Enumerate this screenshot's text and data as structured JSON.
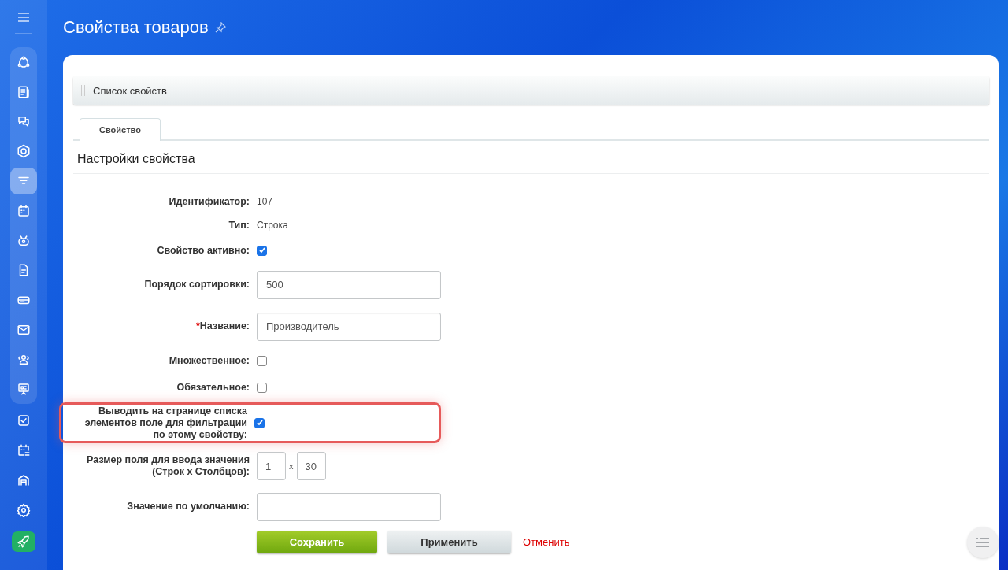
{
  "sidebar": {
    "panel_items": [
      {
        "kind": "flow",
        "selected": false
      },
      {
        "kind": "news",
        "selected": false
      },
      {
        "kind": "chat",
        "selected": false
      },
      {
        "kind": "hexagon",
        "selected": false
      },
      {
        "kind": "filter",
        "selected": true
      },
      {
        "kind": "calendar",
        "selected": false
      },
      {
        "kind": "robot",
        "selected": false
      },
      {
        "kind": "document",
        "selected": false
      },
      {
        "kind": "drive",
        "selected": false
      },
      {
        "kind": "mail",
        "selected": false
      },
      {
        "kind": "people",
        "selected": false
      },
      {
        "kind": "board",
        "selected": false
      }
    ],
    "items": [
      {
        "kind": "task",
        "selected": false
      },
      {
        "kind": "calendar-list",
        "selected": false
      },
      {
        "kind": "garage",
        "selected": false
      },
      {
        "kind": "gear",
        "selected": false
      },
      {
        "kind": "rocket",
        "selected": false
      }
    ]
  },
  "page_title": "Свойства товаров",
  "toolbar": {
    "button": "Список свойств"
  },
  "tabs": [
    {
      "label": "Свойство",
      "selected": true
    }
  ],
  "section_title": "Настройки свойства",
  "fields": [
    {
      "kind": "text",
      "label": "Идентификатор:",
      "value": "107"
    },
    {
      "kind": "text",
      "label": "Тип:",
      "value": "Строка"
    },
    {
      "kind": "checkbox",
      "label": "Свойство активно:",
      "checked": true,
      "highlighted": false
    },
    {
      "kind": "input",
      "label": "Порядок сортировки:",
      "value": "500"
    },
    {
      "kind": "input",
      "label": "Название:",
      "required_mark": "*",
      "value": "Производитель"
    },
    {
      "kind": "checkbox",
      "label": "Множественное:",
      "checked": false,
      "highlighted": false
    },
    {
      "kind": "checkbox",
      "label": "Обязательное:",
      "checked": false,
      "highlighted": false
    },
    {
      "kind": "checkbox",
      "label": "Выводить на странице списка элементов поле для фильтрации по этому свойству:",
      "checked": true,
      "highlighted": true
    },
    {
      "kind": "size",
      "label": "Размер поля для ввода значения (Строк x Столбцов):",
      "rows": "1",
      "separator": "x",
      "cols": "30"
    },
    {
      "kind": "input",
      "label": "Значение по умолчанию:"
    }
  ],
  "buttons": [
    {
      "kind": "primary",
      "label": "Сохранить"
    },
    {
      "kind": "secondary",
      "label": "Применить"
    },
    {
      "kind": "link",
      "label": "Отменить"
    }
  ]
}
